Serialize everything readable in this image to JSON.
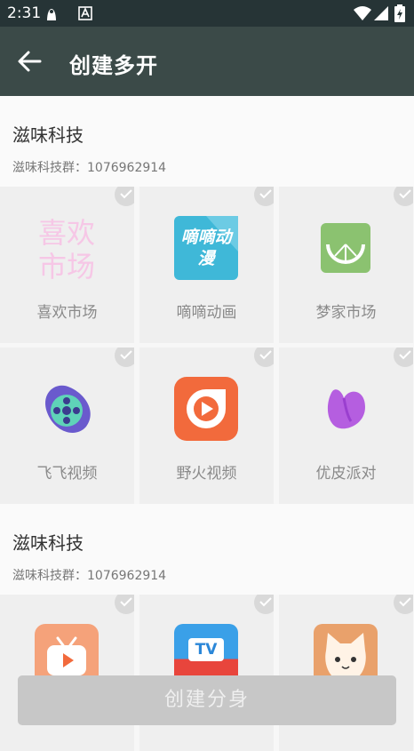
{
  "status_bar": {
    "time": "2:31"
  },
  "header": {
    "title": "创建多开"
  },
  "sections": [
    {
      "name": "滋味科技",
      "group": "滋味科技群：1076962914",
      "apps": [
        {
          "label": "喜欢市场",
          "icon_text": "喜欢市场",
          "icon": "xihuan-market-icon"
        },
        {
          "label": "嘀嘀动画",
          "icon_text": "嘀嘀动漫",
          "icon": "didi-anime-icon"
        },
        {
          "label": "梦家市场",
          "icon": "lemon-market-icon"
        },
        {
          "label": "飞飞视频",
          "icon": "film-reel-icon"
        },
        {
          "label": "野火视频",
          "icon": "play-video-icon"
        },
        {
          "label": "优皮派对",
          "icon": "purple-blob-icon"
        }
      ]
    },
    {
      "name": "滋味科技",
      "group": "滋味科技群：1076962914",
      "apps": [
        {
          "icon": "tv-play-icon"
        },
        {
          "icon_text": "TV",
          "icon": "tv-app-icon"
        },
        {
          "icon": "cat-icon"
        }
      ]
    }
  ],
  "footer": {
    "create_button": "创建分身"
  },
  "colors": {
    "app_bar": "#3b4a48",
    "status_bar": "#263436",
    "button_disabled": "#c7c7c7"
  }
}
